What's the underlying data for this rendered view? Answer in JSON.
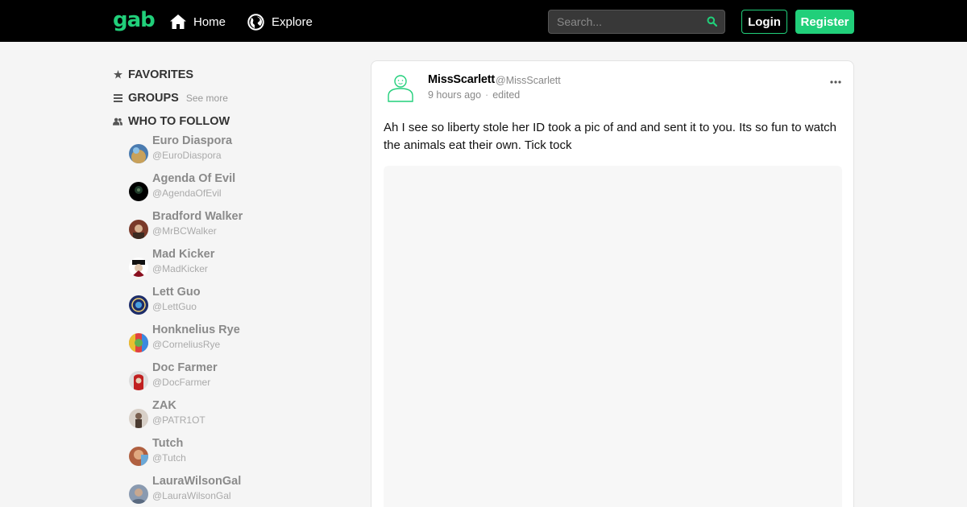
{
  "header": {
    "logo": "gab",
    "nav": [
      {
        "label": "Home",
        "icon": "home-icon"
      },
      {
        "label": "Explore",
        "icon": "globe-icon"
      }
    ],
    "search": {
      "placeholder": "Search...",
      "value": "",
      "icon": "search-icon"
    },
    "login_label": "Login",
    "register_label": "Register"
  },
  "colors": {
    "brand": "#21cf7a",
    "topbar_bg": "#000000",
    "page_bg": "#f5f5f5"
  },
  "sidebar": {
    "favorites": {
      "label": "FAVORITES",
      "icon": "star-icon"
    },
    "groups": {
      "label": "GROUPS",
      "icon": "list-icon",
      "see_more": "See more"
    },
    "who_to_follow": {
      "label": "WHO TO FOLLOW",
      "icon": "users-icon"
    },
    "follow": [
      {
        "name": "Euro Diaspora",
        "handle": "@EuroDiaspora"
      },
      {
        "name": "Agenda Of Evil",
        "handle": "@AgendaOfEvil"
      },
      {
        "name": "Bradford Walker",
        "handle": "@MrBCWalker"
      },
      {
        "name": "Mad Kicker",
        "handle": "@MadKicker"
      },
      {
        "name": "Lett Guo",
        "handle": "@LettGuo"
      },
      {
        "name": "Honknelius Rye",
        "handle": "@CorneliusRye"
      },
      {
        "name": "Doc Farmer",
        "handle": "@DocFarmer"
      },
      {
        "name": "ZAK",
        "handle": "@PATR1OT"
      },
      {
        "name": "Tutch",
        "handle": "@Tutch"
      },
      {
        "name": "LauraWilsonGal",
        "handle": "@LauraWilsonGal"
      }
    ]
  },
  "post": {
    "author_name": "MissScarlett",
    "author_handle": "@MissScarlett",
    "time": "9 hours ago",
    "separator": "·",
    "edited": "edited",
    "text": "Ah I see so liberty stole her ID took a pic of and and sent it to you.  Its so fun to watch the animals eat their own. Tick tock",
    "more_icon": "more-horizontal-icon"
  }
}
